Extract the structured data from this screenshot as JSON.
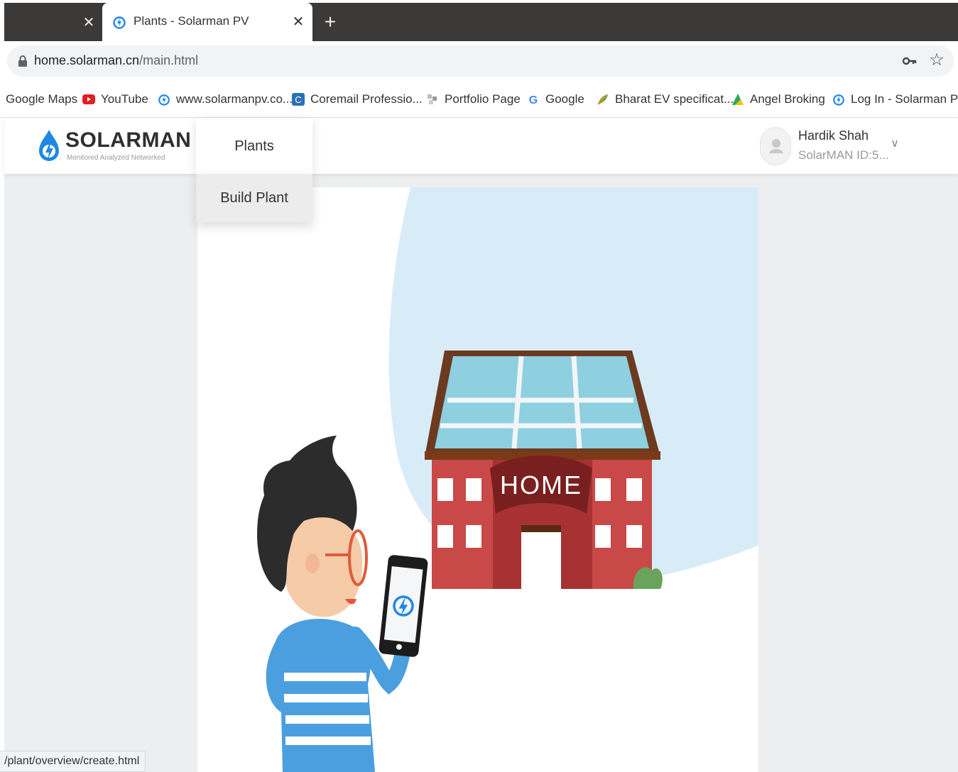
{
  "browser": {
    "tab_title": "Plants - Solarman PV",
    "url_host": "home.solarman.cn",
    "url_path": "/main.html",
    "bookmarks": [
      {
        "label": "Google Maps",
        "icon": "none"
      },
      {
        "label": "YouTube",
        "icon": "youtube-icon"
      },
      {
        "label": "www.solarmanpv.co...",
        "icon": "solarman-icon"
      },
      {
        "label": "Coremail Professio...",
        "icon": "coremail-icon"
      },
      {
        "label": "Portfolio Page",
        "icon": "portfolio-icon"
      },
      {
        "label": "Google",
        "icon": "google-icon"
      },
      {
        "label": "Bharat EV specificat...",
        "icon": "leaf-icon"
      },
      {
        "label": "Angel Broking",
        "icon": "angel-icon"
      },
      {
        "label": "Log In - Solarman PV",
        "icon": "solarman-icon"
      }
    ],
    "status_text": "/plant/overview/create.html"
  },
  "app": {
    "logo_word": "SOLARMAN",
    "logo_tagline": "Monitored Analyzed Networked",
    "nav_plants": "Plants",
    "dropdown_item": "Build Plant",
    "user_name": "Hardik Shah",
    "user_id": "SolarMAN ID:5...",
    "illustration_sign": "HOME"
  },
  "colors": {
    "brand_blue": "#1e88e5",
    "roof_brown": "#6b3a1f",
    "house_red": "#c94848",
    "sky_blue": "#d8ecf8"
  }
}
